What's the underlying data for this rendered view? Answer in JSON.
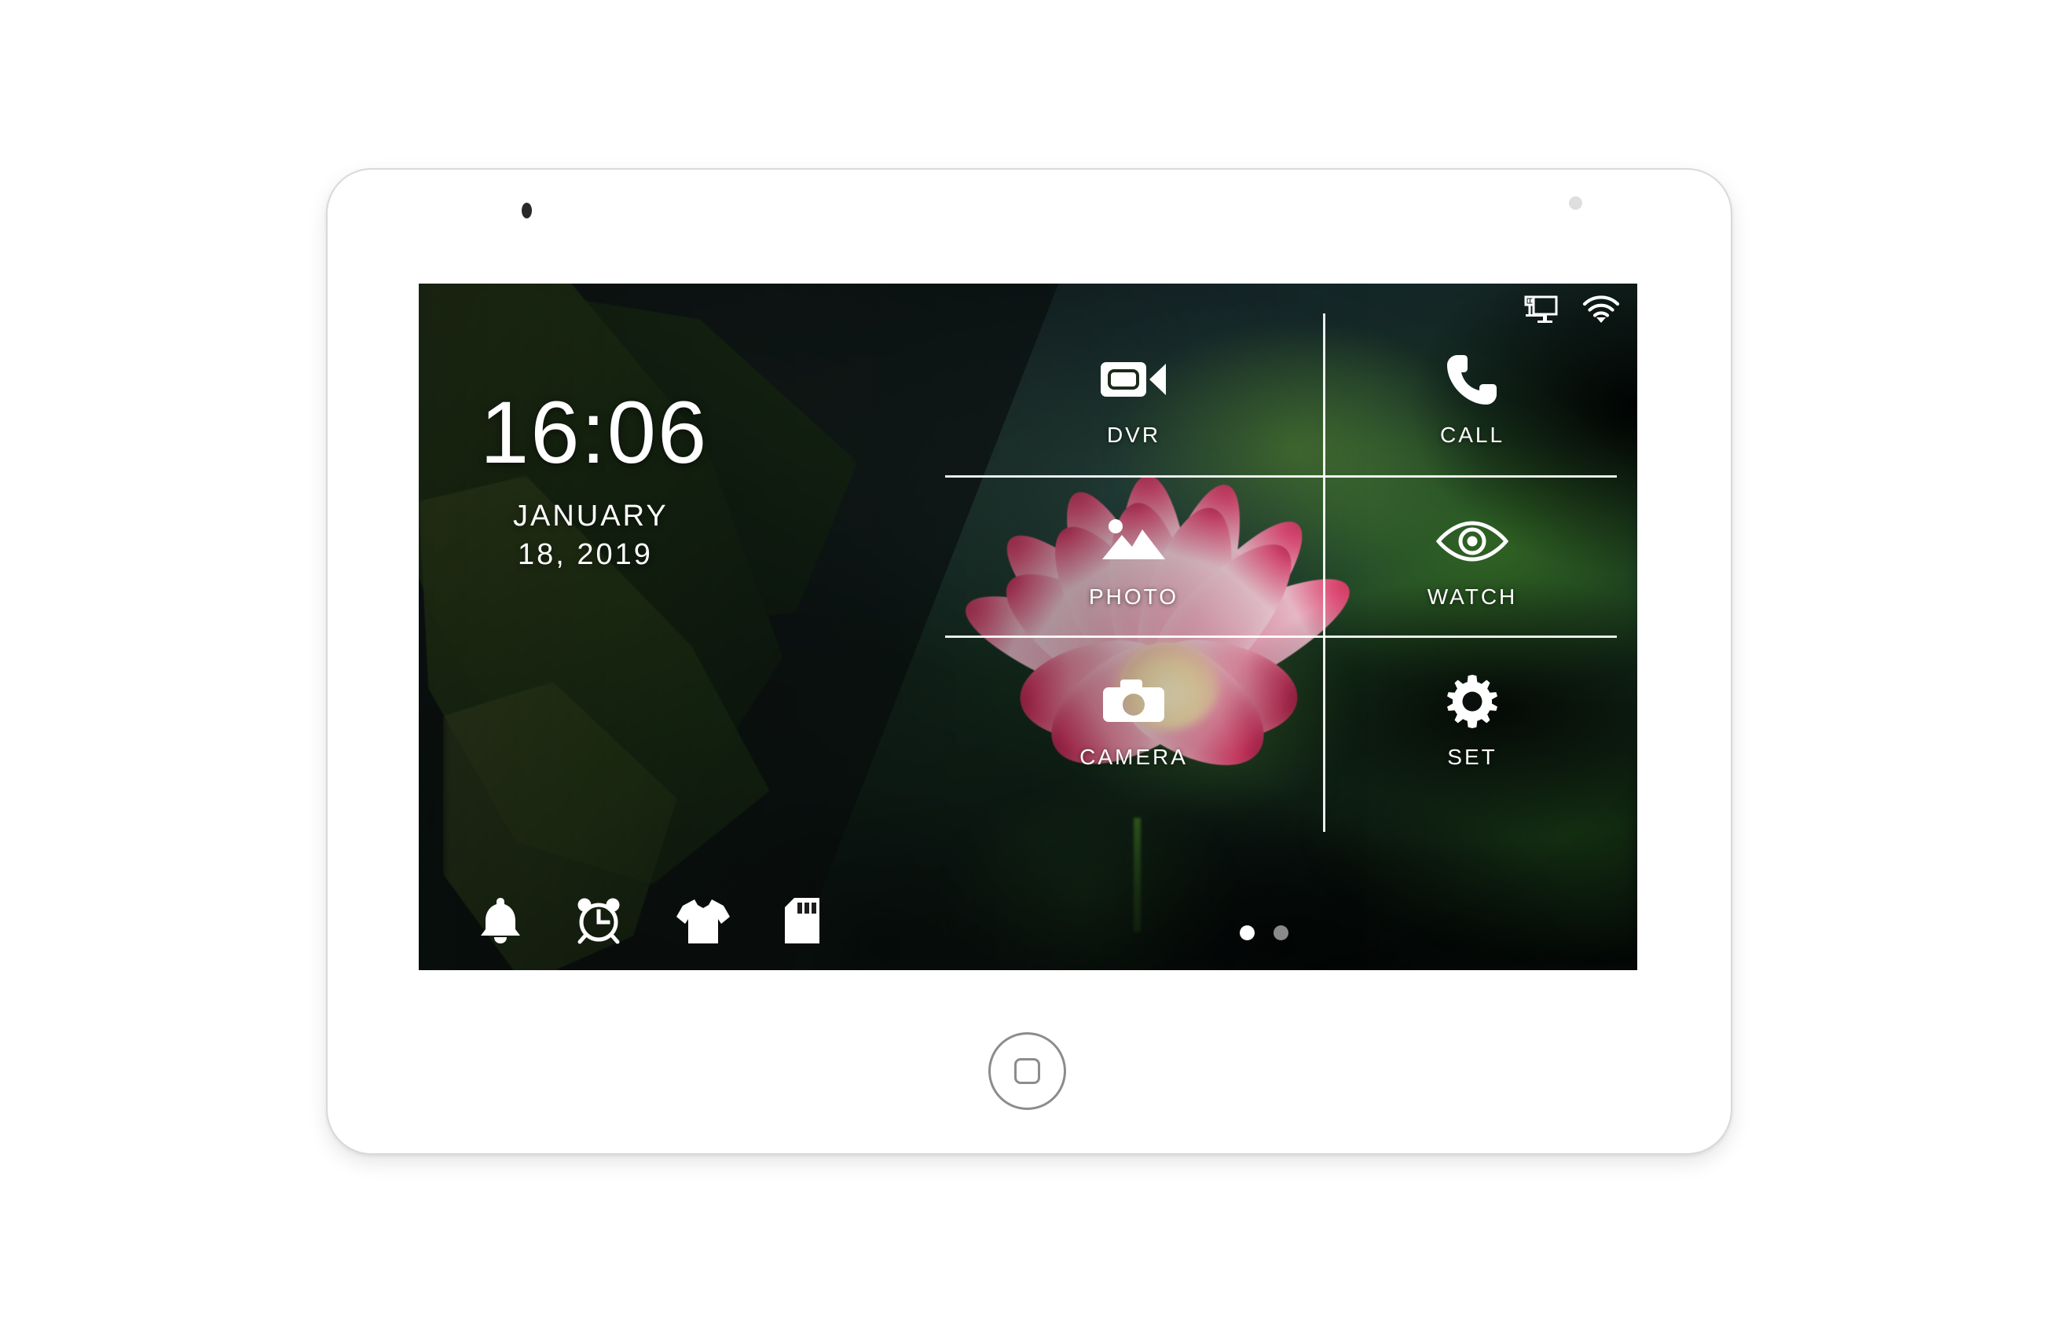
{
  "device": {
    "type": "tablet-indoor-monitor",
    "front_camera": "camera-dot",
    "sensor": "sensor-dot",
    "home_button": "home-button"
  },
  "screen": {
    "status_bar": {
      "icons": [
        {
          "name": "network-monitor-icon",
          "label": "Network monitor"
        },
        {
          "name": "wifi-icon",
          "label": "Wi-Fi"
        }
      ]
    },
    "clock": {
      "time": "16:06",
      "date_line_1": "JANUARY",
      "date_line_2": "18, 2019"
    },
    "menu": {
      "left_column": [
        {
          "id": "dvr",
          "label": "DVR",
          "icon": "video-camera-icon"
        },
        {
          "id": "photo",
          "label": "PHOTO",
          "icon": "image-mountain-icon"
        },
        {
          "id": "camera",
          "label": "CAMERA",
          "icon": "camera-icon"
        }
      ],
      "right_column": [
        {
          "id": "call",
          "label": "CALL",
          "icon": "phone-icon"
        },
        {
          "id": "watch",
          "label": "WATCH",
          "icon": "eye-icon"
        },
        {
          "id": "set",
          "label": "SET",
          "icon": "gear-icon"
        }
      ]
    },
    "tray": [
      {
        "id": "ring",
        "icon": "bell-icon",
        "label": "Ring"
      },
      {
        "id": "alarm",
        "icon": "alarm-clock-icon",
        "label": "Alarm"
      },
      {
        "id": "theme",
        "icon": "tshirt-icon",
        "label": "Theme"
      },
      {
        "id": "sd-card",
        "icon": "sd-card-icon",
        "label": "SD card"
      }
    ],
    "page_indicator": {
      "total": 2,
      "active_index": 0
    },
    "colors": {
      "text": "#ffffff",
      "page_dot_active": "#ffffff",
      "page_dot_inactive": "#8a8a8a",
      "screen_background": "#060a06",
      "bezel": "#ffffff"
    }
  }
}
